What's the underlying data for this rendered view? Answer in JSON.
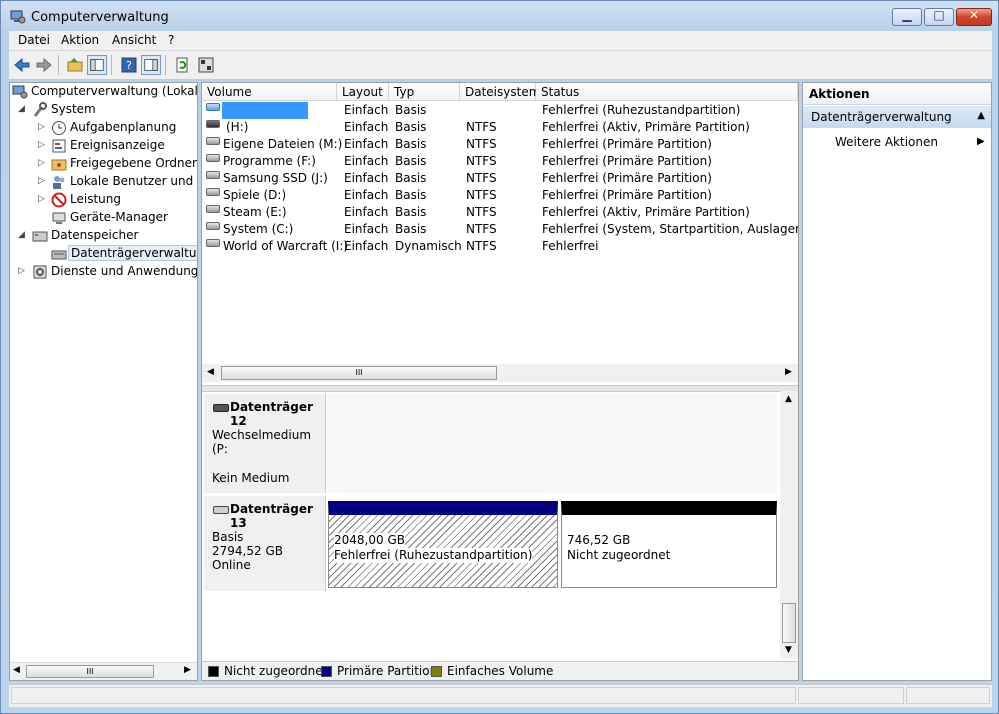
{
  "window": {
    "title": "Computerverwaltung"
  },
  "menu": [
    "Datei",
    "Aktion",
    "Ansicht",
    "?"
  ],
  "tree": {
    "root": "Computerverwaltung (Lokal)",
    "system": "System",
    "aufgaben": "Aufgabenplanung",
    "ereignis": "Ereignisanzeige",
    "freigaben": "Freigegebene Ordner",
    "benutzer": "Lokale Benutzer und Gru",
    "leistung": "Leistung",
    "geraete": "Geräte-Manager",
    "datenspeicher": "Datenspeicher",
    "datentraeger": "Datenträgerverwaltung",
    "dienste": "Dienste und Anwendungen"
  },
  "columns": [
    "Volume",
    "Layout",
    "Typ",
    "Dateisystem",
    "Status"
  ],
  "volumes": [
    {
      "volume": "",
      "layout": "Einfach",
      "typ": "Basis",
      "fs": "",
      "status": "Fehlerfrei (Ruhezustandpartition)"
    },
    {
      "volume": "(H:)",
      "layout": "Einfach",
      "typ": "Basis",
      "fs": "NTFS",
      "status": "Fehlerfrei (Aktiv, Primäre Partition)"
    },
    {
      "volume": "Eigene Dateien (M:)",
      "layout": "Einfach",
      "typ": "Basis",
      "fs": "NTFS",
      "status": "Fehlerfrei (Primäre Partition)"
    },
    {
      "volume": "Programme (F:)",
      "layout": "Einfach",
      "typ": "Basis",
      "fs": "NTFS",
      "status": "Fehlerfrei (Primäre Partition)"
    },
    {
      "volume": "Samsung SSD (J:)",
      "layout": "Einfach",
      "typ": "Basis",
      "fs": "NTFS",
      "status": "Fehlerfrei (Primäre Partition)"
    },
    {
      "volume": "Spiele (D:)",
      "layout": "Einfach",
      "typ": "Basis",
      "fs": "NTFS",
      "status": "Fehlerfrei (Primäre Partition)"
    },
    {
      "volume": "Steam (E:)",
      "layout": "Einfach",
      "typ": "Basis",
      "fs": "NTFS",
      "status": "Fehlerfrei (Aktiv, Primäre Partition)"
    },
    {
      "volume": "System (C:)",
      "layout": "Einfach",
      "typ": "Basis",
      "fs": "NTFS",
      "status": "Fehlerfrei (System, Startpartition, Auslagerungsd"
    },
    {
      "volume": "World of Warcraft (I:)",
      "layout": "Einfach",
      "typ": "Dynamisch",
      "fs": "NTFS",
      "status": "Fehlerfrei"
    }
  ],
  "scroll_marker": "III",
  "disk12": {
    "title": "Datenträger 12",
    "type": "Wechselmedium (P:",
    "state": "Kein Medium"
  },
  "disk13": {
    "title": "Datenträger 13",
    "type": "Basis",
    "size": "2794,52 GB",
    "state": "Online",
    "part1_size": "2048,00 GB",
    "part1_status": "Fehlerfrei (Ruhezustandpartition)",
    "part2_size": "746,52 GB",
    "part2_status": "Nicht zugeordnet"
  },
  "legend": [
    {
      "label": "Nicht zugeordnet",
      "color": "#000000"
    },
    {
      "label": "Primäre Partition",
      "color": "#000080"
    },
    {
      "label": "Einfaches Volume",
      "color": "#808000"
    }
  ],
  "actions": {
    "header": "Aktionen",
    "section": "Datenträgerverwaltung",
    "more": "Weitere Aktionen"
  }
}
